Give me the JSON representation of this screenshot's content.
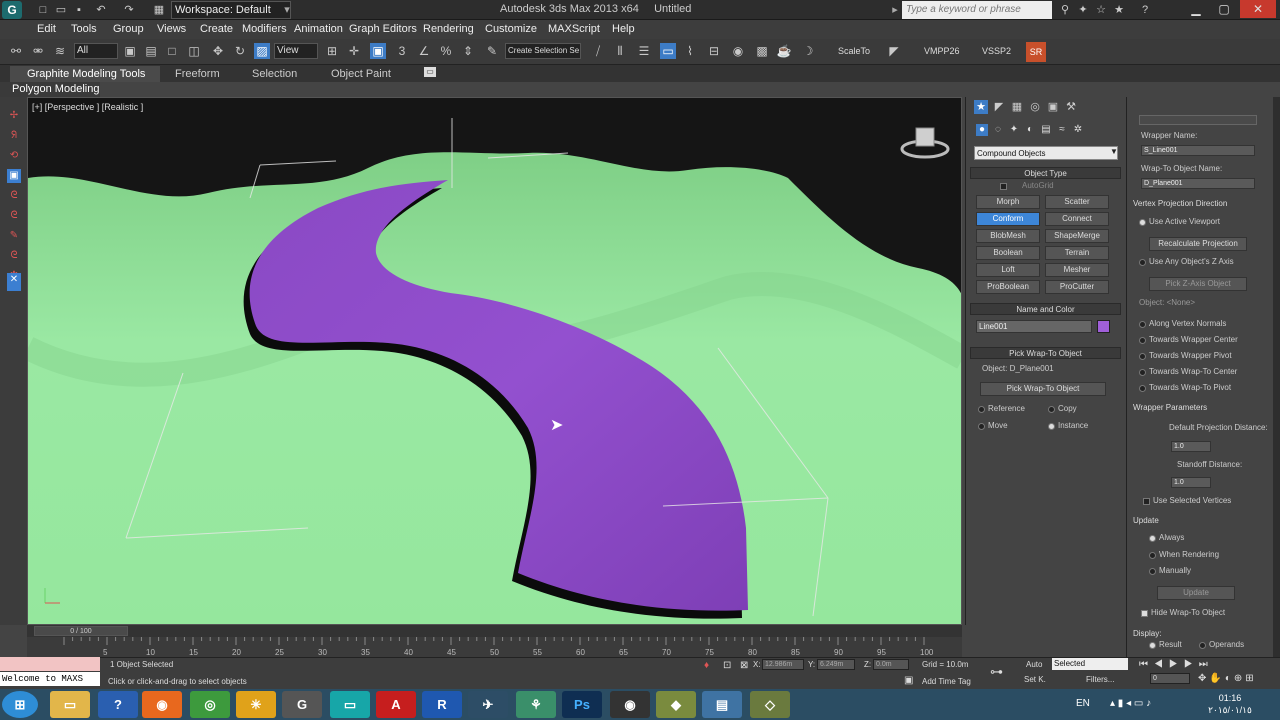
{
  "titlebar": {
    "app_title": "Autodesk 3ds Max  2013 x64",
    "file_title": "Untitled",
    "workspace": "Workspace: Default",
    "search_placeholder": "Type a keyword or phrase"
  },
  "menubar": {
    "items": [
      "Edit",
      "Tools",
      "Group",
      "Views",
      "Create",
      "Modifiers",
      "Animation",
      "Graph Editors",
      "Rendering",
      "Customize",
      "MAXScript",
      "Help"
    ]
  },
  "toolbar": {
    "filter": "All",
    "refcoord": "View",
    "selection_set": "Create Selection Se",
    "buttons": [
      "ScaleTo",
      "VMPP26",
      "VSSP2"
    ],
    "sr_label": "SR"
  },
  "ribbon": {
    "tabs": [
      "Graphite Modeling Tools",
      "Freeform",
      "Selection",
      "Object Paint"
    ],
    "panel_label": "Polygon Modeling"
  },
  "viewport": {
    "label": "[+] [Perspective ] [Realistic ]"
  },
  "command_panel": {
    "category": "Compound Objects",
    "object_type": {
      "title": "Object Type",
      "autogrid": "AutoGrid",
      "buttons": [
        "Morph",
        "Scatter",
        "Conform",
        "Connect",
        "BlobMesh",
        "ShapeMerge",
        "Boolean",
        "Terrain",
        "Loft",
        "Mesher",
        "ProBoolean",
        "ProCutter"
      ]
    },
    "name_color": {
      "title": "Name and Color",
      "name": "Line001",
      "color": "#a05fd9"
    },
    "pick_wrap": {
      "title": "Pick Wrap-To Object",
      "object": "Object: D_Plane001",
      "button": "Pick Wrap-To Object",
      "options": [
        "Reference",
        "Copy",
        "Move",
        "Instance"
      ]
    }
  },
  "right_panel": {
    "wrapper_name_label": "Wrapper Name:",
    "wrapper_name": "S_Line001",
    "wrap_to_label": "Wrap-To Object Name:",
    "wrap_to_name": "D_Plane001",
    "vpd_title": "Vertex Projection Direction",
    "use_active_viewport": "Use Active Viewport",
    "recalculate": "Recalculate Projection",
    "use_any_z": "Use Any Object's Z Axis",
    "pick_z": "Pick Z-Axis Object",
    "object_none": "Object: <None>",
    "along_vertex": "Along Vertex Normals",
    "towards_wrapper_center": "Towards Wrapper Center",
    "towards_wrapper_pivot": "Towards Wrapper Pivot",
    "towards_wrapto_center": "Towards Wrap-To Center",
    "towards_wrapto_pivot": "Towards Wrap-To Pivot",
    "wrapper_params_title": "Wrapper Parameters",
    "default_proj_label": "Default Projection Distance:",
    "default_proj_value": "1.0",
    "standoff_label": "Standoff Distance:",
    "standoff_value": "1.0",
    "use_selected_vertices": "Use Selected Vertices",
    "update_title": "Update",
    "always": "Always",
    "when_rendering": "When Rendering",
    "manually": "Manually",
    "update_button": "Update",
    "hide_wrapto": "Hide Wrap-To Object",
    "display_title": "Display:",
    "result": "Result",
    "operands": "Operands"
  },
  "timeline": {
    "slider": "0 / 100",
    "ticks": [
      "5",
      "10",
      "15",
      "20",
      "25",
      "30",
      "35",
      "40",
      "45",
      "50",
      "55",
      "60",
      "65",
      "70",
      "75",
      "80",
      "85",
      "90",
      "95",
      "100"
    ]
  },
  "status": {
    "maxscript": "Welcome to MAXS",
    "selected": "1 Object Selected",
    "prompt": "Click or click-and-drag to select objects",
    "x": "12.986m",
    "y": "6.249m",
    "z": "0.0m",
    "grid": "Grid = 10.0m",
    "add_time_tag": "Add Time Tag",
    "auto": "Auto",
    "set_key": "Set K.",
    "key_filter": "Selected",
    "filters": "Filters...",
    "frame": "0"
  },
  "taskbar": {
    "lang": "EN",
    "time": "01:16",
    "date": "٢٠١٥/٠١/١٥"
  }
}
